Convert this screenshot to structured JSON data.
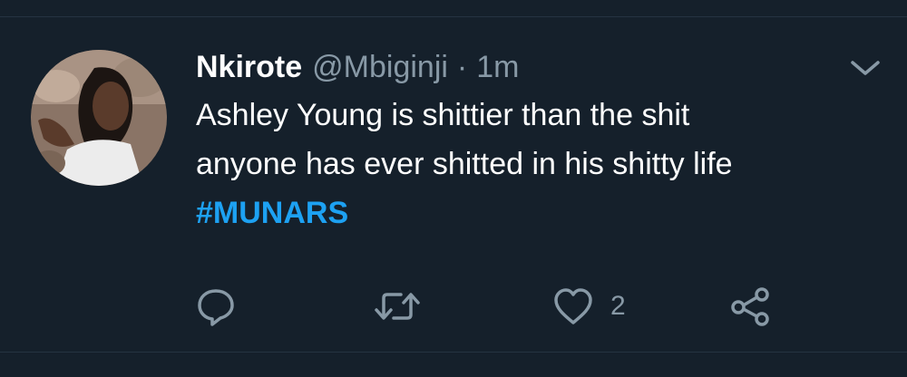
{
  "tweet": {
    "display_name": "Nkirote",
    "handle": "@Mbiginji",
    "separator": "·",
    "time": "1m",
    "text_lines": [
      "Ashley Young is shittier than the shit",
      "anyone has ever shitted in his shitty life"
    ],
    "hashtag": "#MUNARS"
  },
  "actions": {
    "reply_icon": "comment-bubble-icon",
    "retweet_icon": "retweet-arrows-icon",
    "like_icon": "heart-outline-icon",
    "like_count": "2",
    "share_icon": "share-nodes-icon"
  },
  "colors": {
    "background": "#15202b",
    "text_primary": "#ffffff",
    "text_secondary": "#8899a6",
    "hashtag": "#1da1f2",
    "divider": "#253341"
  }
}
